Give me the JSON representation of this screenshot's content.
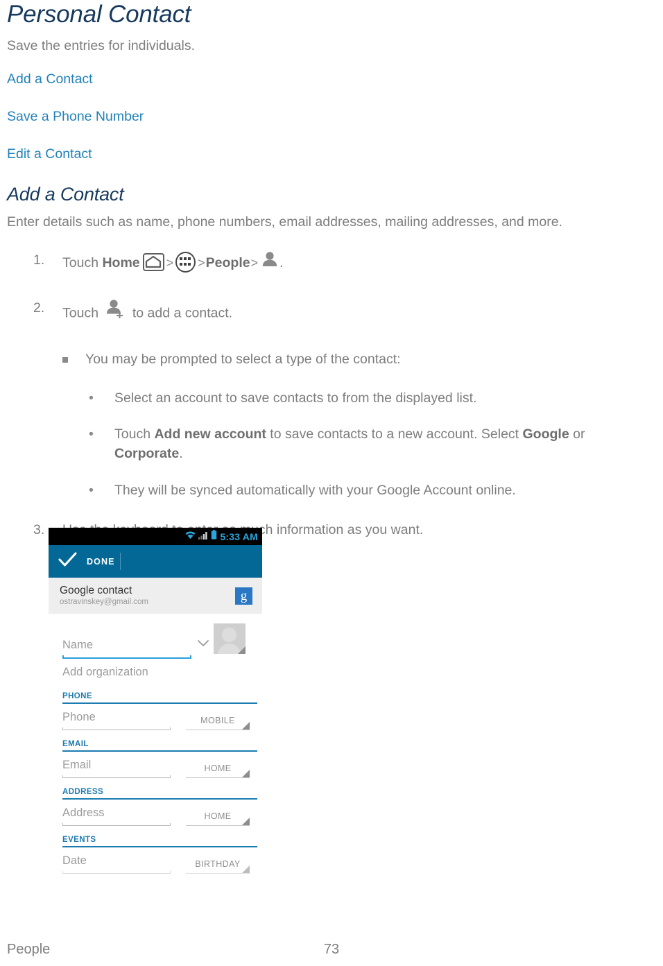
{
  "document": {
    "title": "Personal Contact",
    "intro": "Save the entries for individuals.",
    "links": [
      {
        "label": "Add a Contact"
      },
      {
        "label": "Save a Phone Number"
      },
      {
        "label": "Edit a Contact"
      }
    ],
    "section": {
      "heading": "Add a Contact",
      "intro": "Enter details such as name, phone numbers, email addresses, mailing addresses, and more."
    },
    "steps": [
      {
        "number": "1.",
        "pre": "Touch ",
        "bold1": "Home",
        "icon1": "home-icon",
        "sep1": ">",
        "icon2": "apps-grid-icon",
        "sep2": ">",
        "bold2": "People",
        "sep3": ">",
        "icon3": "person-icon",
        "post": "."
      },
      {
        "number": "2.",
        "pre": "Touch ",
        "icon": "person-add-icon",
        "post": " to add a contact."
      },
      {
        "number": "3.",
        "text": "Use the keyboard to enter as much information as you want."
      }
    ],
    "substeps": {
      "square": "You may be prompted to select a type of the contact:",
      "dots": [
        {
          "text": "Select an account to save contacts to from the displayed list."
        },
        {
          "part1": "Touch ",
          "bold1": "Add new account",
          "part2": " to save contacts to a new account.  Select ",
          "bold2": "Google",
          "part3": " or ",
          "bold3": "Corporate",
          "part4": "."
        },
        {
          "text": "They will be synced automatically with your Google Account online."
        }
      ]
    },
    "footer": {
      "chapter": "People",
      "page": "73"
    },
    "colors": {
      "heading": "#16395e",
      "link": "#2180b8",
      "body_text": "#7d7d7d",
      "android_accent": "#036895",
      "android_section": "#1c7bb0",
      "status_clock": "#2aa5dd"
    }
  },
  "screenshot": {
    "statusbar": {
      "wifi_icon": "wifi-icon",
      "signal_icon": "signal-bars-icon",
      "battery_icon": "battery-icon",
      "clock": "5:33 AM"
    },
    "actionbar": {
      "check_icon": "checkmark-icon",
      "done_label": "DONE"
    },
    "account": {
      "name": "Google contact",
      "email": "ostravinskey@gmail.com",
      "badge": "g"
    },
    "fields": [
      {
        "name": "name",
        "hint": "Name",
        "type": null,
        "kind": "name"
      },
      {
        "name": "org",
        "hint": "Add organization",
        "type": null,
        "kind": "plain"
      }
    ],
    "sections": [
      {
        "label": "PHONE",
        "field": {
          "hint": "Phone",
          "type": "MOBILE"
        }
      },
      {
        "label": "EMAIL",
        "field": {
          "hint": "Email",
          "type": "HOME"
        }
      },
      {
        "label": "ADDRESS",
        "field": {
          "hint": "Address",
          "type": "HOME"
        }
      },
      {
        "label": "EVENTS",
        "field": {
          "hint": "Date",
          "type": "BIRTHDAY"
        }
      }
    ]
  }
}
